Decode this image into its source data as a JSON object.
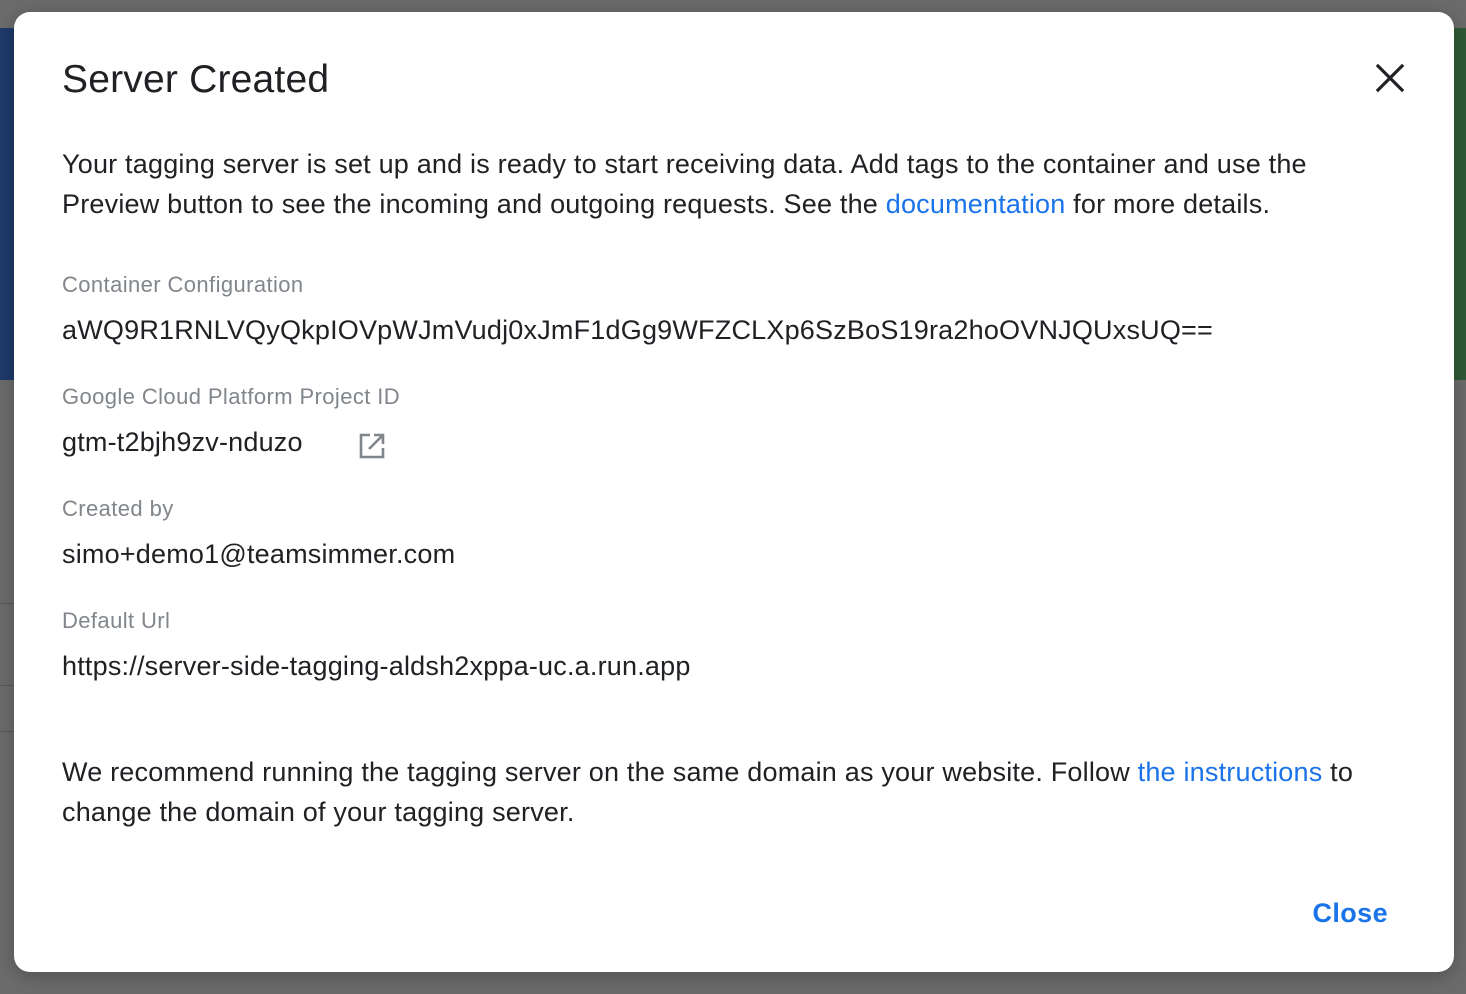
{
  "dialog": {
    "title": "Server Created",
    "close_icon": "close-icon",
    "intro": {
      "text_before_link": "Your tagging server is set up and is ready to start receiving data. Add tags to the container and use the Preview button to see the incoming and outgoing requests. See the ",
      "link_text": "documentation",
      "text_after_link": " for more details."
    },
    "fields": {
      "container_configuration": {
        "label": "Container Configuration",
        "value": "aWQ9R1RNLVQyQkpIOVpWJmVudj0xJmF1dGg9WFZCLXp6SzBoS19ra2hoOVNJQUxsUQ=="
      },
      "gcp_project_id": {
        "label": "Google Cloud Platform Project ID",
        "value": "gtm-t2bjh9zv-nduzo",
        "icon": "open-in-new-icon"
      },
      "created_by": {
        "label": "Created by",
        "value": "simo+demo1@teamsimmer.com"
      },
      "default_url": {
        "label": "Default Url",
        "value": "https://server-side-tagging-aldsh2xppa-uc.a.run.app"
      }
    },
    "recommendation": {
      "text_before_link": "We recommend running the tagging server on the same domain as your website. Follow ",
      "link_text": "the instructions",
      "text_after_link": " to change the domain of your tagging server."
    },
    "close_button_label": "Close"
  },
  "colors": {
    "link": "#1a73e8",
    "text_primary": "#202124",
    "text_secondary": "#80868b",
    "backdrop": "#6b6b6b"
  }
}
